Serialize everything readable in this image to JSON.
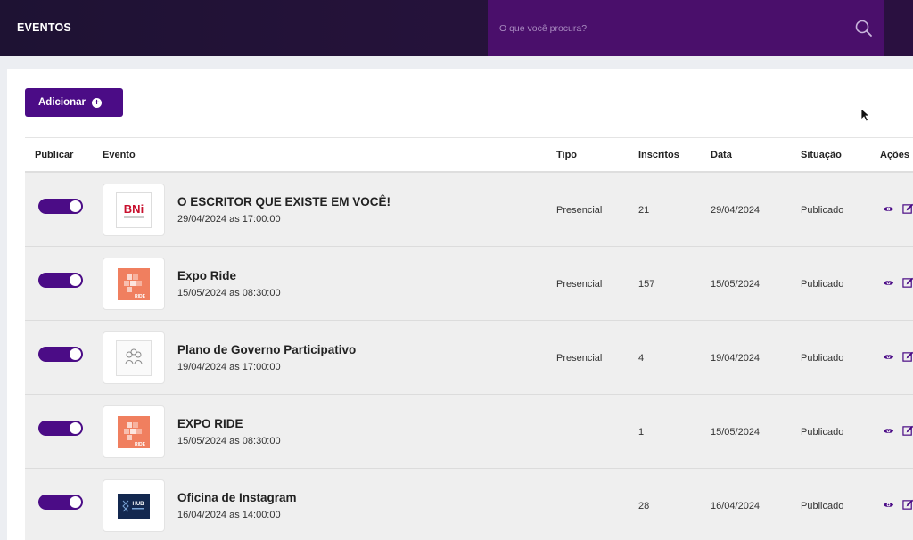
{
  "header": {
    "title": "EVENTOS",
    "search_placeholder": "O que você procura?"
  },
  "toolbar": {
    "add_label": "Adicionar"
  },
  "table": {
    "columns": {
      "publicar": "Publicar",
      "evento": "Evento",
      "tipo": "Tipo",
      "inscritos": "Inscritos",
      "data": "Data",
      "situacao": "Situação",
      "acoes": "Ações"
    },
    "rows": [
      {
        "published": true,
        "thumb_icon": "bni-logo",
        "thumb_text": "BNi",
        "thumb_subtext": "DE PILOTO",
        "name": "O ESCRITOR QUE EXISTE EM VOCÊ!",
        "datetime": "29/04/2024 as 17:00:00",
        "tipo": "Presencial",
        "inscritos": "21",
        "data": "29/04/2024",
        "situacao": "Publicado"
      },
      {
        "published": true,
        "thumb_icon": "expo-ride-logo",
        "thumb_text": "RIDE",
        "thumb_subtext": "",
        "name": "Expo Ride",
        "datetime": "15/05/2024 as 08:30:00",
        "tipo": "Presencial",
        "inscritos": "157",
        "data": "15/05/2024",
        "situacao": "Publicado"
      },
      {
        "published": true,
        "thumb_icon": "people-group-icon",
        "thumb_text": "",
        "thumb_subtext": "",
        "name": "Plano de Governo Participativo",
        "datetime": "19/04/2024 as 17:00:00",
        "tipo": "Presencial",
        "inscritos": "4",
        "data": "19/04/2024",
        "situacao": "Publicado"
      },
      {
        "published": true,
        "thumb_icon": "expo-ride-logo",
        "thumb_text": "RIDE",
        "thumb_subtext": "",
        "name": "EXPO RIDE",
        "datetime": "15/05/2024 as 08:30:00",
        "tipo": "",
        "inscritos": "1",
        "data": "15/05/2024",
        "situacao": "Publicado"
      },
      {
        "published": true,
        "thumb_icon": "hub-logo",
        "thumb_text": "HUB",
        "thumb_subtext": "",
        "name": "Oficina de Instagram",
        "datetime": "16/04/2024 as 14:00:00",
        "tipo": "",
        "inscritos": "28",
        "data": "16/04/2024",
        "situacao": "Publicado"
      }
    ]
  },
  "colors": {
    "accent": "#4b0c86",
    "search_bg": "#4a0f6b",
    "header_bg": "#1e1233",
    "row_bg": "#efefef"
  }
}
